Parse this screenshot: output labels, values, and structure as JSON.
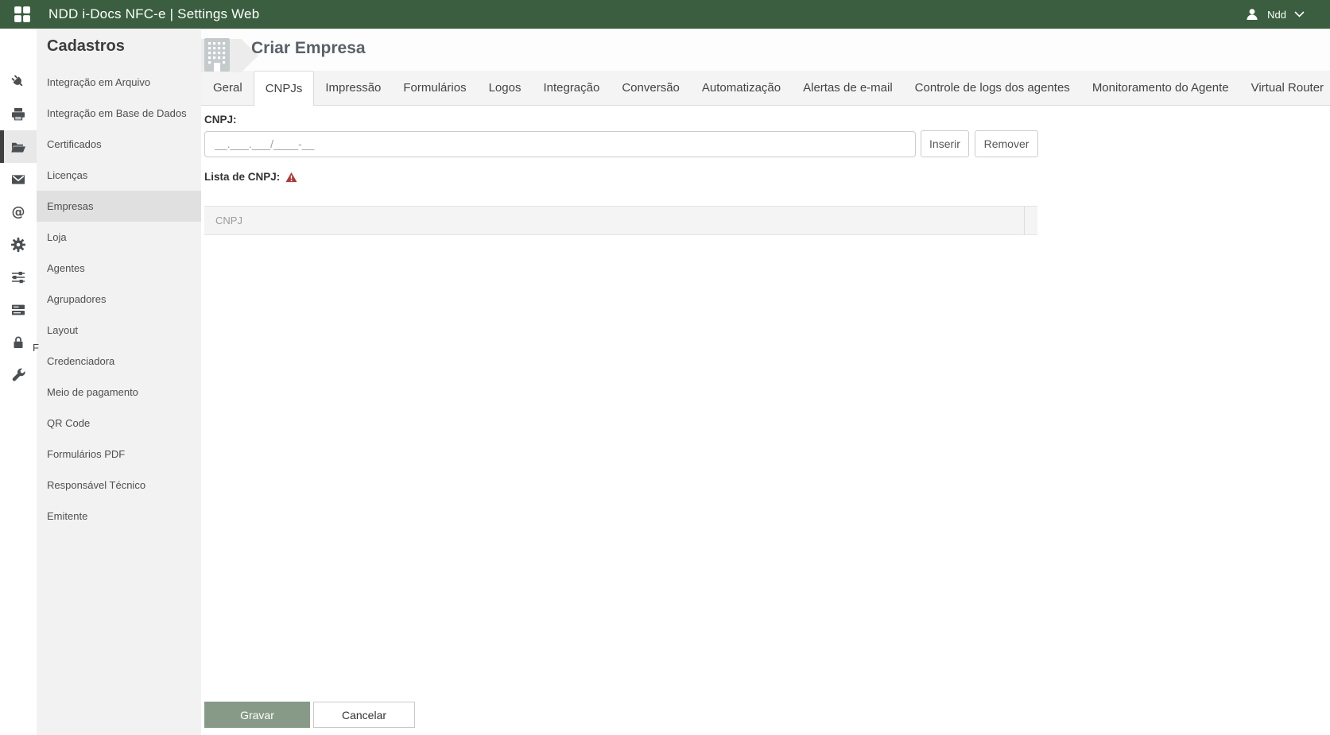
{
  "topbar": {
    "title": "NDD i-Docs NFC-e | Settings Web",
    "user_name": "Ndd"
  },
  "rail": {
    "icons": [
      "plug",
      "printer",
      "folder-open",
      "envelope",
      "at-sign",
      "gear",
      "sliders",
      "server",
      "lock",
      "wrench"
    ],
    "selected_icon": "folder-open",
    "clipped_label": "F"
  },
  "sidebar": {
    "heading": "Cadastros",
    "items": [
      "Integração em Arquivo",
      "Integração em Base de Dados",
      "Certificados",
      "Licenças",
      "Empresas",
      "Loja",
      "Agentes",
      "Agrupadores",
      "Layout",
      "Credenciadora",
      "Meio de pagamento",
      "QR Code",
      "Formulários PDF",
      "Responsável Técnico",
      "Emitente"
    ],
    "selected_item": "Empresas"
  },
  "page": {
    "title": "Criar Empresa"
  },
  "tabs": {
    "items": [
      "Geral",
      "CNPJs",
      "Impressão",
      "Formulários",
      "Logos",
      "Integração",
      "Conversão",
      "Automatização",
      "Alertas de e-mail",
      "Controle de logs dos agentes",
      "Monitoramento do Agente",
      "Virtual Router"
    ],
    "active": "CNPJs"
  },
  "form": {
    "cnpj_label": "CNPJ:",
    "cnpj_value": "",
    "cnpj_placeholder": "__.___.___/____-__",
    "insert_button": "Inserir",
    "remove_button": "Remover",
    "list_label": "Lista de CNPJ:"
  },
  "grid": {
    "columns": [
      "CNPJ"
    ],
    "rows": []
  },
  "actions": {
    "save_button": "Gravar",
    "cancel_button": "Cancelar"
  },
  "colors": {
    "topbar_green": "#3A5E3F",
    "save_green": "#879A88",
    "warning_red": "#A63D3C",
    "sidebar_gray": "#F2F2F2",
    "selected_gray": "#E0E0E0"
  }
}
